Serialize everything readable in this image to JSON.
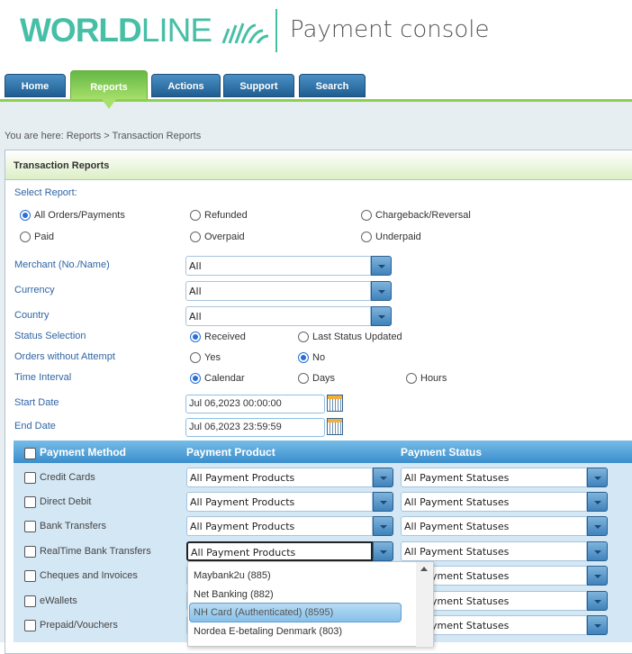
{
  "header": {
    "logo_bold": "WORLD",
    "logo_light": "LINE",
    "app_title": "Payment console"
  },
  "nav": {
    "tabs": [
      "Home",
      "Reports",
      "Actions",
      "Support",
      "Search"
    ],
    "active": "Reports"
  },
  "breadcrumb": "You are here: Reports > Transaction Reports",
  "panel_title": "Transaction Reports",
  "select_report": {
    "label": "Select Report:",
    "options": [
      "All Orders/Payments",
      "Refunded",
      "Chargeback/Reversal",
      "Paid",
      "Overpaid",
      "Underpaid"
    ],
    "selected": "All Orders/Payments"
  },
  "fields": {
    "merchant": {
      "label": "Merchant (No./Name)",
      "value": "All"
    },
    "currency": {
      "label": "Currency",
      "value": "All"
    },
    "country": {
      "label": "Country",
      "value": "All"
    },
    "status_selection": {
      "label": "Status Selection",
      "options": [
        "Received",
        "Last Status Updated"
      ],
      "selected": "Received"
    },
    "orders_without_attempt": {
      "label": "Orders without Attempt",
      "options": [
        "Yes",
        "No"
      ],
      "selected": "No"
    },
    "time_interval": {
      "label": "Time Interval",
      "options": [
        "Calendar",
        "Days",
        "Hours"
      ],
      "selected": "Calendar"
    },
    "start_date": {
      "label": "Start Date",
      "value": "Jul 06,2023 00:00:00"
    },
    "end_date": {
      "label": "End Date",
      "value": "Jul 06,2023 23:59:59"
    }
  },
  "payment_table": {
    "headers": [
      "Payment Method",
      "Payment Product",
      "Payment Status"
    ],
    "rows": [
      {
        "method": "Credit Cards",
        "product": "All Payment Products",
        "status": "All Payment Statuses"
      },
      {
        "method": "Direct Debit",
        "product": "All Payment Products",
        "status": "All Payment Statuses"
      },
      {
        "method": "Bank Transfers",
        "product": "All Payment Products",
        "status": "All Payment Statuses"
      },
      {
        "method": "RealTime Bank Transfers",
        "product": "All Payment Products",
        "status": "All Payment Statuses"
      },
      {
        "method": "Cheques and Invoices",
        "product": "",
        "status": "All Payment Statuses"
      },
      {
        "method": "eWallets",
        "product": "",
        "status": "All Payment Statuses"
      },
      {
        "method": "Prepaid/Vouchers",
        "product": "",
        "status": "All Payment Statuses"
      }
    ]
  },
  "dropdown": {
    "options": [
      "Maybank2u (885)",
      "Net Banking (882)",
      "NH Card (Authenticated) (8595)",
      "Nordea E-betaling Denmark (803)"
    ],
    "highlighted": "NH Card (Authenticated) (8595)"
  },
  "colors": {
    "brand": "#46bfa6",
    "nav": "#1f5e93",
    "active_tab": "#66b846",
    "table_header": "#3a8dcc"
  }
}
